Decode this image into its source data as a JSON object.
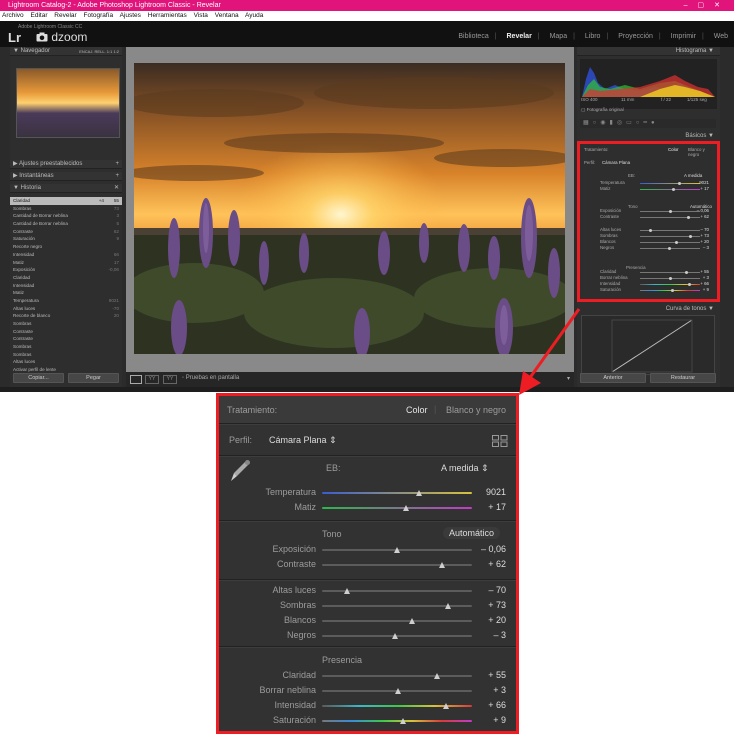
{
  "window": {
    "title": "Lightroom Catalog-2 - Adobe Photoshop Lightroom Classic - Revelar",
    "menu": [
      "Archivo",
      "Editar",
      "Revelar",
      "Fotografía",
      "Ajustes",
      "Herramientas",
      "Vista",
      "Ventana",
      "Ayuda"
    ]
  },
  "identity": {
    "sub": "Adobe Lightroom Classic CC",
    "logo": "Lr",
    "brand": "dzoom"
  },
  "modules": [
    "Biblioteca",
    "Revelar",
    "Mapa",
    "Libro",
    "Proyección",
    "Imprimir",
    "Web"
  ],
  "active_module": "Revelar",
  "left_panel": {
    "navigator": {
      "label": "Navegador",
      "zoom_options": "ENCAJ.   RELL.   1:1   1:2"
    },
    "presets": "Ajustes preestablecidos",
    "snapshots": "Instantáneas",
    "history": "Historia",
    "history_items": [
      {
        "name": "Claridad",
        "a": "+4",
        "b": "55"
      },
      {
        "name": "Sombras",
        "a": "",
        "b": "73"
      },
      {
        "name": "Cantidad de Borrar neblina",
        "a": "",
        "b": "3"
      },
      {
        "name": "Cantidad de Borrar neblina",
        "a": "",
        "b": "5"
      },
      {
        "name": "Contraste",
        "a": "",
        "b": "62"
      },
      {
        "name": "Saturación",
        "a": "",
        "b": "9"
      },
      {
        "name": "Recorte negro",
        "a": "",
        "b": ""
      },
      {
        "name": "Intensidad",
        "a": "",
        "b": "66"
      },
      {
        "name": "Matiz",
        "a": "",
        "b": "17"
      },
      {
        "name": "Exposición",
        "a": "",
        "b": "-0,06"
      },
      {
        "name": "Claridad",
        "a": "",
        "b": ""
      },
      {
        "name": "Intensidad",
        "a": "",
        "b": ""
      },
      {
        "name": "Matiz",
        "a": "",
        "b": ""
      },
      {
        "name": "Temperatura",
        "a": "",
        "b": "9021"
      },
      {
        "name": "Altas luces",
        "a": "",
        "b": "-70"
      },
      {
        "name": "Recorte de blanco",
        "a": "",
        "b": "20"
      },
      {
        "name": "Sombras",
        "a": "",
        "b": ""
      },
      {
        "name": "Contraste",
        "a": "",
        "b": ""
      },
      {
        "name": "Contraste",
        "a": "",
        "b": ""
      },
      {
        "name": "Sombras",
        "a": "",
        "b": ""
      },
      {
        "name": "Sombras",
        "a": "",
        "b": ""
      },
      {
        "name": "Altas luces",
        "a": "",
        "b": ""
      },
      {
        "name": "Activar perfil de lente",
        "a": "",
        "b": ""
      }
    ],
    "copy_button": "Copiar...",
    "paste_button": "Pegar"
  },
  "toolbar": {
    "soft_proof": "Pruebas en pantalla"
  },
  "right_panel": {
    "histogram_label": "Histograma",
    "histogram_meta": [
      "ISO 400",
      "11 mm",
      "f / 22",
      "1/125 seg"
    ],
    "original_photo": "Fotografía original",
    "basic_label": "Básicos",
    "tone_curve_label": "Curva de tonos",
    "prev_button": "Anterior",
    "reset_button": "Restaurar"
  },
  "basics": {
    "treatment_label": "Tratamiento:",
    "treatment_color": "Color",
    "treatment_bw": "Blanco y negro",
    "profile_label": "Perfil:",
    "profile_value": "Cámara Plana",
    "wb_label": "EB:",
    "wb_value": "A medida",
    "temperature": {
      "label": "Temperatura",
      "value": "9021",
      "pos": 0.65
    },
    "tint": {
      "label": "Matiz",
      "value": "+ 17",
      "pos": 0.56
    },
    "tone_label": "Tono",
    "auto_label": "Automático",
    "exposure": {
      "label": "Exposición",
      "value": "– 0,06",
      "pos": 0.5
    },
    "contrast": {
      "label": "Contraste",
      "value": "+ 62",
      "pos": 0.8
    },
    "highlights": {
      "label": "Altas luces",
      "value": "– 70",
      "pos": 0.17
    },
    "shadows": {
      "label": "Sombras",
      "value": "+ 73",
      "pos": 0.84
    },
    "whites": {
      "label": "Blancos",
      "value": "+ 20",
      "pos": 0.6
    },
    "blacks": {
      "label": "Negros",
      "value": "– 3",
      "pos": 0.49
    },
    "presence_label": "Presencia",
    "clarity": {
      "label": "Claridad",
      "value": "+ 55",
      "pos": 0.77
    },
    "dehaze": {
      "label": "Borrar neblina",
      "value": "+ 3",
      "pos": 0.51
    },
    "vibrance": {
      "label": "Intensidad",
      "value": "+ 66",
      "pos": 0.83
    },
    "saturation": {
      "label": "Saturación",
      "value": "+ 9",
      "pos": 0.54
    }
  },
  "colors": {
    "accent_red": "#ee1d23",
    "title_pink": "#e0147a"
  }
}
